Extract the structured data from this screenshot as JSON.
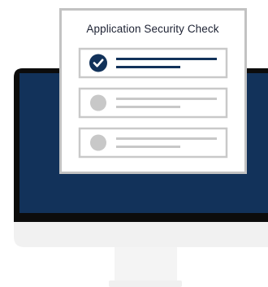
{
  "card": {
    "title": "Application Security Check",
    "items": [
      {
        "status": "checked",
        "icon": "checkmark-icon"
      },
      {
        "status": "pending",
        "icon": "circle-icon"
      },
      {
        "status": "pending",
        "icon": "circle-icon"
      }
    ]
  },
  "colors": {
    "screen": "#12325a",
    "bezel": "#0c0c0c",
    "chin": "#f1f1f1",
    "stand": "#f4f4f4",
    "card_border": "#c2c2c2",
    "card_bg": "#ffffff",
    "accent": "#12325a",
    "pending": "#c8c8c8"
  }
}
